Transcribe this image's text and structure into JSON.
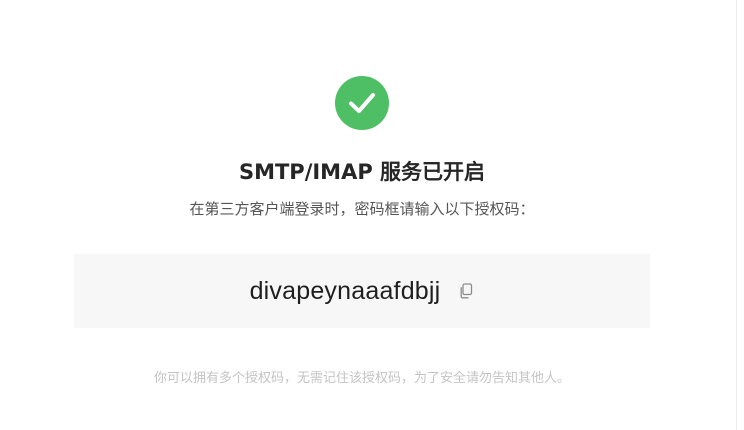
{
  "status": {
    "icon": "check-circle-icon",
    "color": "#4fbf66",
    "title": "SMTP/IMAP 服务已开启",
    "subtitle": "在第三方客户端登录时，密码框请输入以下授权码："
  },
  "auth_code": {
    "value": "divapeynaaafdbjj",
    "copy_icon": "copy-icon"
  },
  "note": "你可以拥有多个授权码，无需记住该授权码，为了安全请勿告知其他人。"
}
